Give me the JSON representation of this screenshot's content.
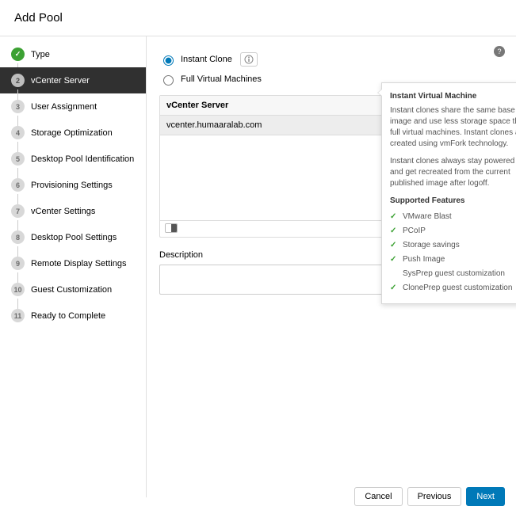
{
  "header": {
    "title": "Add Pool"
  },
  "sidebar": {
    "steps": [
      {
        "num": "✓",
        "label": "Type",
        "state": "done"
      },
      {
        "num": "2",
        "label": "vCenter Server",
        "state": "active"
      },
      {
        "num": "3",
        "label": "User Assignment",
        "state": "pending"
      },
      {
        "num": "4",
        "label": "Storage Optimization",
        "state": "pending"
      },
      {
        "num": "5",
        "label": "Desktop Pool Identification",
        "state": "pending"
      },
      {
        "num": "6",
        "label": "Provisioning Settings",
        "state": "pending"
      },
      {
        "num": "7",
        "label": "vCenter Settings",
        "state": "pending"
      },
      {
        "num": "8",
        "label": "Desktop Pool Settings",
        "state": "pending"
      },
      {
        "num": "9",
        "label": "Remote Display Settings",
        "state": "pending"
      },
      {
        "num": "10",
        "label": "Guest Customization",
        "state": "pending"
      },
      {
        "num": "11",
        "label": "Ready to Complete",
        "state": "pending"
      }
    ]
  },
  "content": {
    "option_instant": "Instant Clone",
    "option_full": "Full Virtual Machines",
    "table": {
      "header": "vCenter Server",
      "row": "vcenter.humaaralab.com"
    },
    "desc_label": "Description",
    "desc_value": ""
  },
  "popover": {
    "title": "Instant Virtual Machine",
    "p1": "Instant clones share the same base image and use less storage space than full virtual machines. Instant clones are created using vmFork technology.",
    "p2": "Instant clones always stay powered on and get recreated from the current published image after logoff.",
    "subtitle": "Supported Features",
    "features": [
      {
        "check": true,
        "label": "VMware Blast"
      },
      {
        "check": true,
        "label": "PCoIP"
      },
      {
        "check": true,
        "label": "Storage savings"
      },
      {
        "check": true,
        "label": "Push Image"
      },
      {
        "check": false,
        "label": "SysPrep guest customization",
        "indent": true
      },
      {
        "check": true,
        "label": "ClonePrep guest customization"
      }
    ]
  },
  "footer": {
    "cancel": "Cancel",
    "previous": "Previous",
    "next": "Next"
  }
}
